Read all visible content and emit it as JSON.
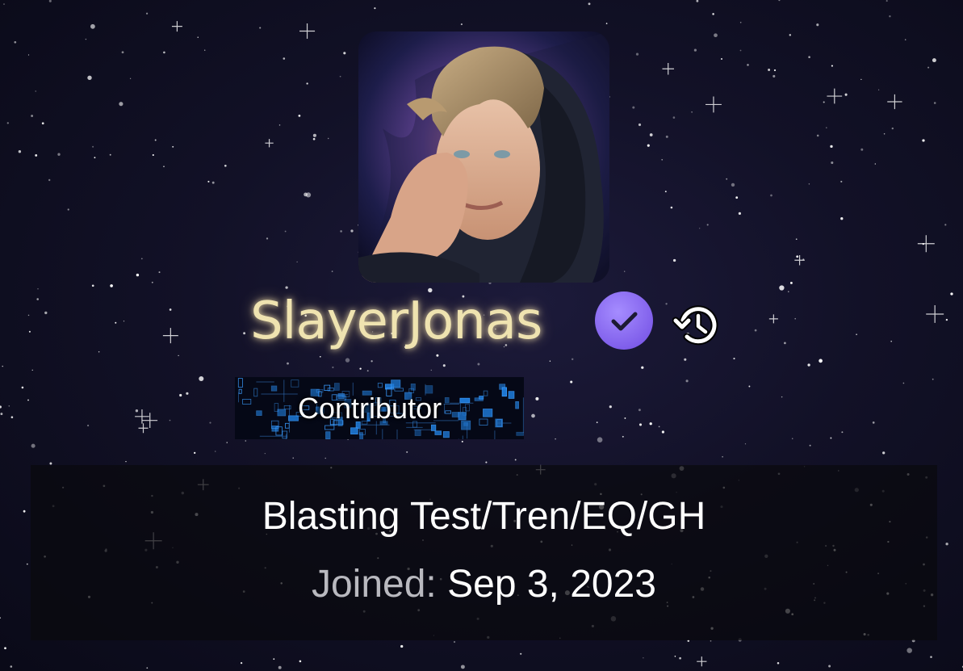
{
  "profile": {
    "username": "SlayerJonas",
    "role": "Contributor",
    "custom_title": "Blasting Test/Tren/EQ/GH",
    "joined_label": "Joined:",
    "joined_value": "Sep 3, 2023"
  },
  "icons": {
    "verified": "verified-check-icon",
    "history": "history-icon"
  },
  "colors": {
    "username": "#efe3b0",
    "verified_badge": "#8c6cf2",
    "background": "#121127"
  }
}
